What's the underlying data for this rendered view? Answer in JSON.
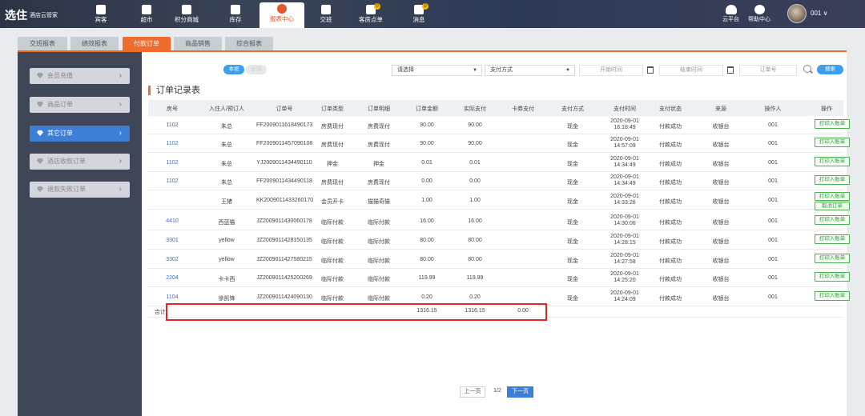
{
  "app": {
    "logo_text": "选住",
    "logo_sub": "酒店云管家"
  },
  "nav": [
    {
      "label": "宾客",
      "icon": "guest-icon",
      "badge": ""
    },
    {
      "label": "超市",
      "icon": "cart-icon",
      "badge": ""
    },
    {
      "label": "积分商城",
      "icon": "shop-icon",
      "badge": ""
    },
    {
      "label": "库存",
      "icon": "box-icon",
      "badge": ""
    },
    {
      "label": "报表中心",
      "icon": "pie-chart-icon",
      "badge": "",
      "active": true
    },
    {
      "label": "交班",
      "icon": "handover-icon",
      "badge": ""
    },
    {
      "label": "客房点单",
      "icon": "room-order-icon",
      "badge": "0"
    },
    {
      "label": "消息",
      "icon": "message-icon",
      "badge": "0"
    }
  ],
  "top_right": {
    "cloud_label": "云平台",
    "help_label": "帮助中心",
    "user_label": "001 ∨"
  },
  "subtabs": [
    "交班报表",
    "绩效报表",
    "付款订单",
    "商品销售",
    "综合报表"
  ],
  "subtab_active": 2,
  "side_menu": [
    {
      "label": "会员充值",
      "active": false
    },
    {
      "label": "商品订单",
      "active": false
    },
    {
      "label": "其它订单",
      "active": true
    },
    {
      "label": "酒店收款订单",
      "active": false
    },
    {
      "label": "退款失败订单",
      "active": false
    }
  ],
  "filters": {
    "toggle_on": "本班",
    "toggle_off": "全部",
    "select1": "请选择",
    "select2": "支付方式",
    "start_placeholder": "开始时间",
    "end_placeholder": "结束时间",
    "order_placeholder": "订单号",
    "search_label": "搜索"
  },
  "section_title": "订单记录表",
  "table": {
    "headers": [
      "房号",
      "入住人/预订人",
      "订单号",
      "订单类型",
      "订单明细",
      "订单金额",
      "实际支付",
      "卡券支付",
      "支付方式",
      "支付时间",
      "支付状态",
      "来源",
      "操作人",
      "操作"
    ],
    "rows": [
      {
        "room": "1102",
        "guest": "朱总",
        "order_no": "FF2009011618490173",
        "type": "房费现付",
        "detail": "房费现付",
        "amount": "90.00",
        "paid": "90.00",
        "coupon": "",
        "method": "现金",
        "date": "2020-09-01",
        "time": "16:18:49",
        "status": "付款成功",
        "source": "收银台",
        "operator": "001",
        "actions": [
          "打印入账单"
        ]
      },
      {
        "room": "1102",
        "guest": "朱总",
        "order_no": "FF2009011457090108",
        "type": "房费现付",
        "detail": "房费现付",
        "amount": "90.00",
        "paid": "90.00",
        "coupon": "",
        "method": "现金",
        "date": "2020-09-01",
        "time": "14:57:09",
        "status": "付款成功",
        "source": "收银台",
        "operator": "001",
        "actions": [
          "打印入账单"
        ]
      },
      {
        "room": "1102",
        "guest": "朱总",
        "order_no": "YJ2009011434490110",
        "type": "押金",
        "detail": "押金",
        "amount": "0.01",
        "paid": "0.01",
        "coupon": "",
        "method": "现金",
        "date": "2020-09-01",
        "time": "14:34:49",
        "status": "付款成功",
        "source": "收银台",
        "operator": "001",
        "actions": [
          "打印入账单"
        ]
      },
      {
        "room": "1102",
        "guest": "朱总",
        "order_no": "FF2009011434490118",
        "type": "房费现付",
        "detail": "房费现付",
        "amount": "0.00",
        "paid": "0.00",
        "coupon": "",
        "method": "现金",
        "date": "2020-09-01",
        "time": "14:34:49",
        "status": "付款成功",
        "source": "收银台",
        "operator": "001",
        "actions": [
          "打印入账单"
        ]
      },
      {
        "room": "",
        "guest": "王猪",
        "order_no": "KK2009011433260170",
        "type": "会员开卡",
        "detail": "猫猫奇猫",
        "amount": "1.00",
        "paid": "1.00",
        "coupon": "",
        "method": "现金",
        "date": "2020-09-01",
        "time": "14:33:26",
        "status": "付款成功",
        "source": "收银台",
        "operator": "001",
        "actions": [
          "打印入账单",
          "取消订单"
        ]
      },
      {
        "room": "4410",
        "guest": "西蓝猫",
        "order_no": "JZ2009011430060178",
        "type": "临际付款",
        "detail": "临际付款",
        "amount": "16.00",
        "paid": "16.00",
        "coupon": "",
        "method": "现金",
        "date": "2020-09-01",
        "time": "14:30:06",
        "status": "付款成功",
        "source": "收银台",
        "operator": "001",
        "actions": [
          "打印入账单"
        ]
      },
      {
        "room": "3301",
        "guest": "yellow",
        "order_no": "JZ2009011428150135",
        "type": "临际付款",
        "detail": "临际付款",
        "amount": "80.00",
        "paid": "80.00",
        "coupon": "",
        "method": "现金",
        "date": "2020-09-01",
        "time": "14:28:15",
        "status": "付款成功",
        "source": "收银台",
        "operator": "001",
        "actions": [
          "打印入账单"
        ]
      },
      {
        "room": "3302",
        "guest": "yellow",
        "order_no": "JZ2009011427580215",
        "type": "临际付款",
        "detail": "临际付款",
        "amount": "80.00",
        "paid": "80.00",
        "coupon": "",
        "method": "现金",
        "date": "2020-09-01",
        "time": "14:27:58",
        "status": "付款成功",
        "source": "收银台",
        "operator": "001",
        "actions": [
          "打印入账单"
        ]
      },
      {
        "room": "2204",
        "guest": "卡卡西",
        "order_no": "JZ2009011425200269",
        "type": "临际付款",
        "detail": "临际付款",
        "amount": "119.99",
        "paid": "119.99",
        "coupon": "",
        "method": "现金",
        "date": "2020-09-01",
        "time": "14:25:20",
        "status": "付款成功",
        "source": "收银台",
        "operator": "001",
        "actions": [
          "打印入账单"
        ]
      },
      {
        "room": "1104",
        "guest": "徐凯锋",
        "order_no": "JZ2009011424090130",
        "type": "临际付款",
        "detail": "临际付款",
        "amount": "0.20",
        "paid": "0.20",
        "coupon": "",
        "method": "现金",
        "date": "2020-09-01",
        "time": "14:24:09",
        "status": "付款成功",
        "source": "收银台",
        "operator": "001",
        "actions": [
          "打印入账单"
        ]
      }
    ],
    "total": {
      "label": "合计",
      "amount": "1316.15",
      "paid": "1316.15",
      "coupon": "0.00"
    }
  },
  "pagination": {
    "prev": "上一页",
    "info": "1/2",
    "next": "下一页"
  },
  "colors": {
    "accent": "#ef6c2f",
    "primary": "#3d7ed6",
    "highlight": "#e0262b"
  }
}
